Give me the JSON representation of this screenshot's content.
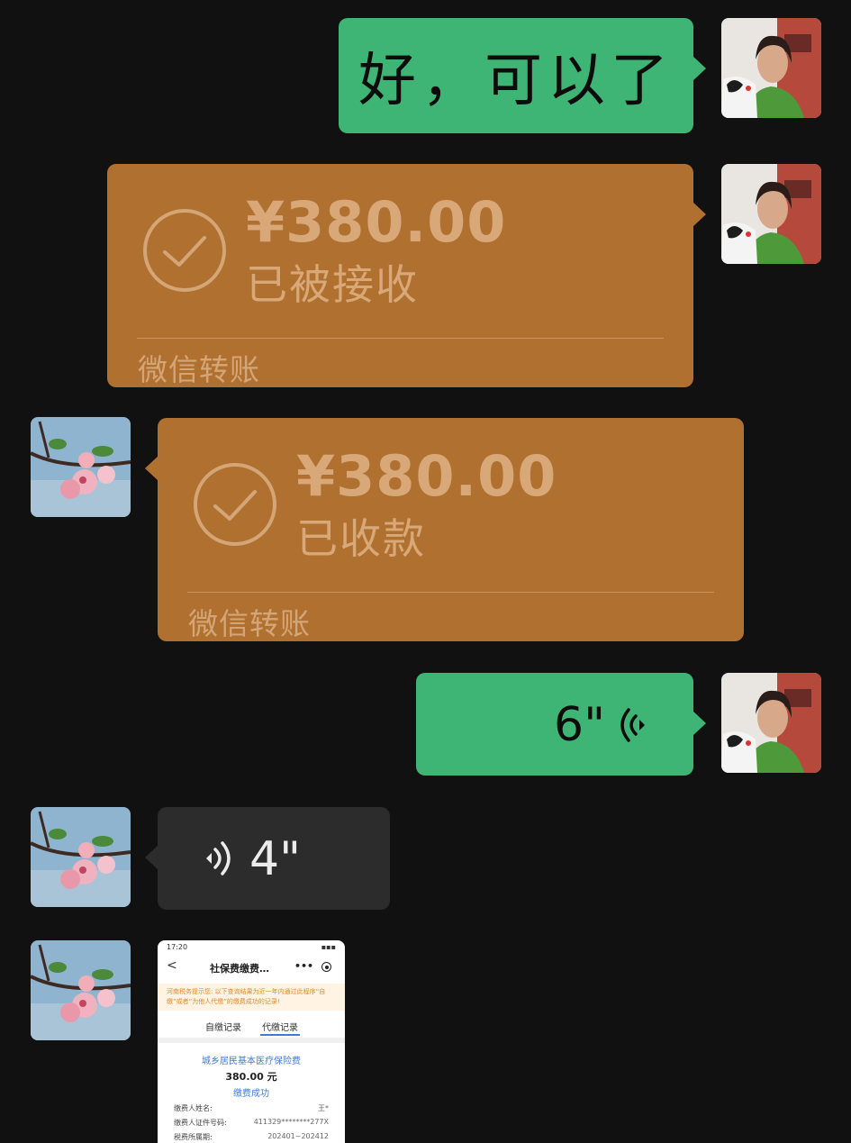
{
  "messages": {
    "text_msg": "好，可以了",
    "transfer_sent": {
      "amount": "¥380.00",
      "status": "已被接收",
      "brand": "微信转账"
    },
    "transfer_received": {
      "amount": "¥380.00",
      "status": "已收款",
      "brand": "微信转账"
    },
    "voice_sent": {
      "duration": "6\""
    },
    "voice_received": {
      "duration": "4\""
    }
  },
  "screenshot": {
    "status_time": "17:20",
    "status_icons": "▪▪▪",
    "back": "<",
    "title": "社保费缴费…",
    "menu": "•••",
    "notice": "河南税务提示您: 以下查询结果为近一年内通过此程序“自缴”或者“为他人代缴”的缴费成功的记录!",
    "tab_self": "自缴记录",
    "tab_proxy": "代缴记录",
    "card_title": "城乡居民基本医疗保险费",
    "card_amount": "380.00 元",
    "card_status": "缴费成功",
    "rows": [
      {
        "label": "缴费人姓名:",
        "value": "王*"
      },
      {
        "label": "缴费人证件号码:",
        "value": "411329********277X"
      },
      {
        "label": "税费所属期:",
        "value": "202401~202412"
      }
    ]
  },
  "colors": {
    "background": "#111111",
    "sent_bubble": "#3eb575",
    "transfer_bubble": "#b07130",
    "received_bubble": "#2c2c2c"
  }
}
